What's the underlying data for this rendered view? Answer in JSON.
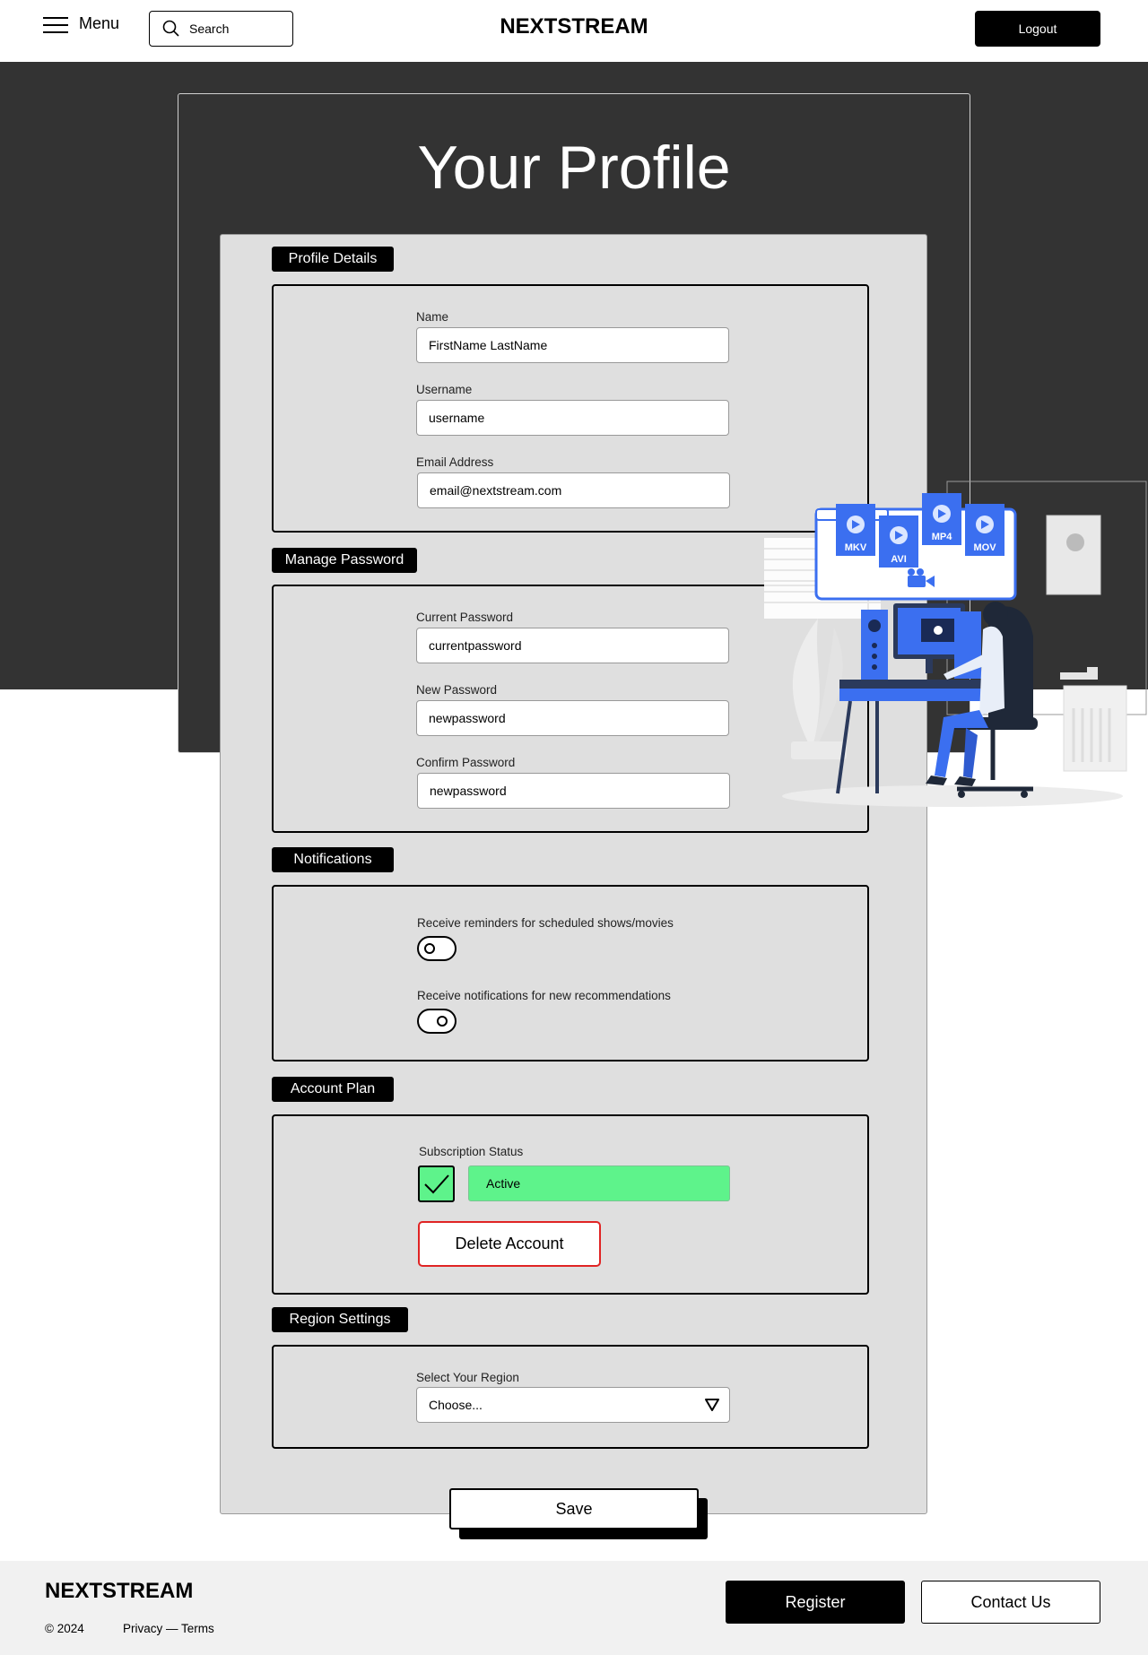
{
  "header": {
    "menu_label": "Menu",
    "search_placeholder": "Search",
    "brand": "NEXTSTREAM",
    "logout_label": "Logout"
  },
  "page": {
    "title": "Your Profile"
  },
  "profile_details": {
    "tag": "Profile Details",
    "name_label": "Name",
    "name_value": "FirstName LastName",
    "username_label": "Username",
    "username_value": "username",
    "email_label": "Email Address",
    "email_value": "email@nextstream.com"
  },
  "manage_password": {
    "tag": "Manage Password",
    "current_label": "Current Password",
    "current_value": "currentpassword",
    "new_label": "New Password",
    "new_value": "newpassword",
    "confirm_label": "Confirm Password",
    "confirm_value": "newpassword"
  },
  "notifications": {
    "tag": "Notifications",
    "reminders_label": "Receive reminders for scheduled shows/movies",
    "reminders_on": false,
    "recommendations_label": "Receive notifications for new recommendations",
    "recommendations_on": true
  },
  "account_plan": {
    "tag": "Account Plan",
    "status_label": "Subscription Status",
    "status_value": "Active",
    "delete_label": "Delete Account"
  },
  "region_settings": {
    "tag": "Region Settings",
    "select_label": "Select Your Region",
    "select_value": "Choose..."
  },
  "save_label": "Save",
  "illustration": {
    "file_badges": [
      "MKV",
      "AVI",
      "MP4",
      "MOV"
    ]
  },
  "footer": {
    "brand": "NEXTSTREAM",
    "copyright": "© 2024",
    "links": "Privacy — Terms",
    "register_label": "Register",
    "contact_label": "Contact Us"
  },
  "colors": {
    "dark_band": "#333333",
    "panel": "#dfdfdf",
    "active_green": "#5ef38b",
    "delete_red": "#e02424",
    "illustration_blue": "#3b6ff0"
  }
}
